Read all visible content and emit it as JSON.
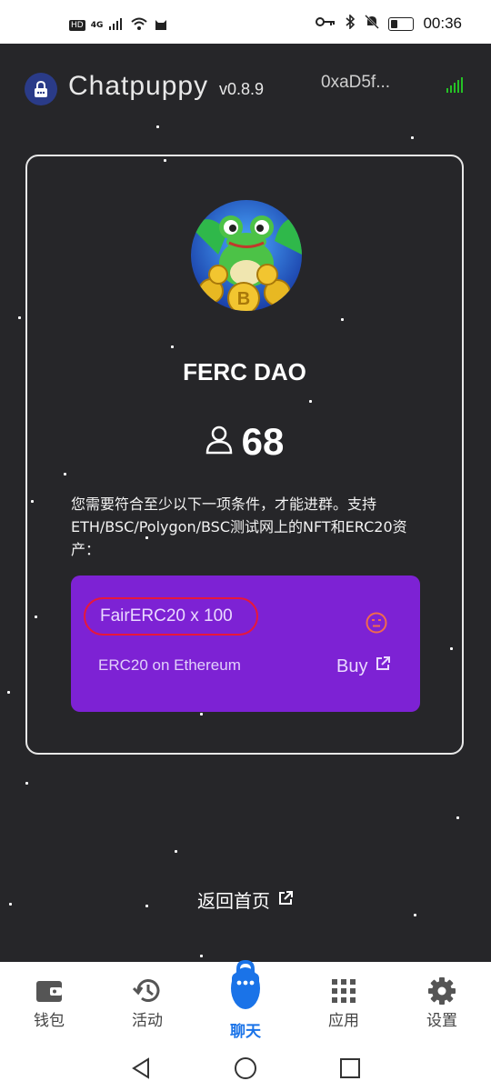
{
  "status_bar": {
    "network_hd": "HD",
    "network_type": "4G",
    "time": "00:36"
  },
  "header": {
    "app_name": "Chatpuppy",
    "version": "v0.8.9",
    "wallet_address": "0xaD5f...",
    "signal_color": "#25c125"
  },
  "group": {
    "name": "FERC DAO",
    "member_count": "68",
    "requirement_text": "您需要符合至少以下一项条件，才能进群。支持ETH/BSC/Polygon/BSC测试网上的NFT和ERC20资产：",
    "conditions": [
      {
        "token": "FairERC20 x 100",
        "chain": "ERC20 on Ethereum",
        "buy_label": "Buy",
        "background": "#7d22d4",
        "highlight": "#e8183a"
      }
    ]
  },
  "home_link": "返回首页",
  "tabs": [
    {
      "label": "钱包",
      "icon": "wallet-icon"
    },
    {
      "label": "活动",
      "icon": "history-icon"
    },
    {
      "label": "聊天",
      "icon": "chat-lock-icon",
      "active": true
    },
    {
      "label": "应用",
      "icon": "apps-grid-icon"
    },
    {
      "label": "设置",
      "icon": "gear-icon"
    }
  ],
  "accent_color": "#1a73e8"
}
